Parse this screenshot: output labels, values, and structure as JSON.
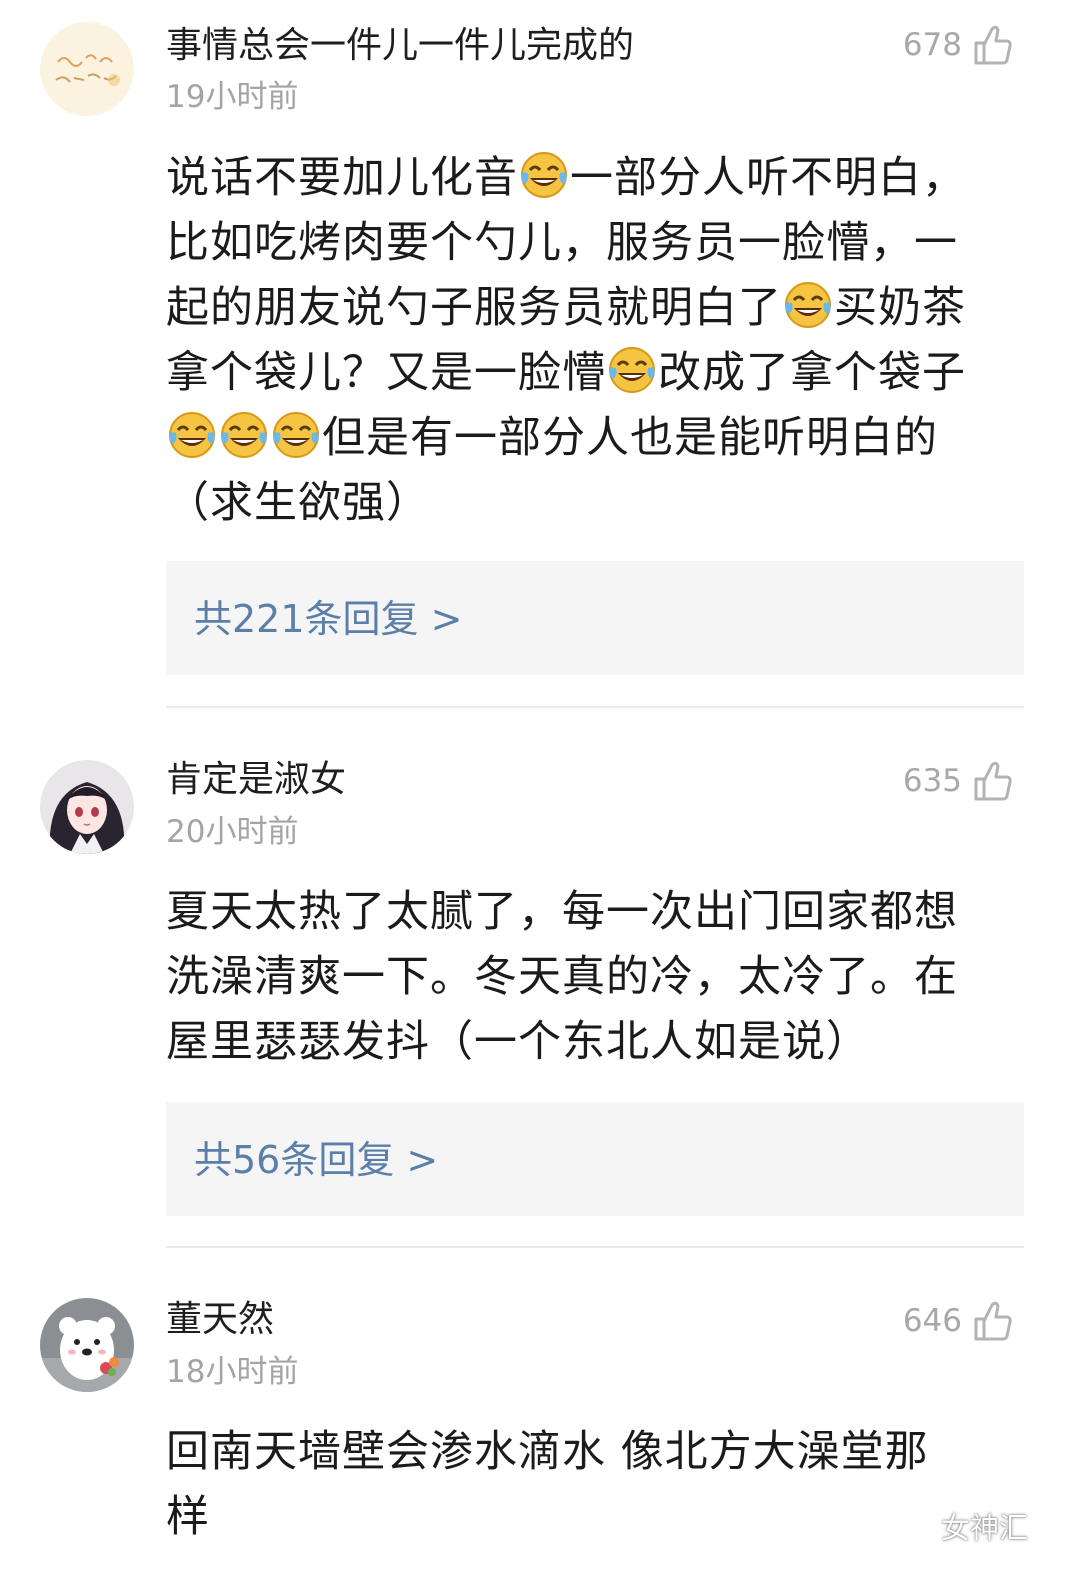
{
  "colors": {
    "reply_link": "#5b7fa8",
    "muted": "#a4a4a4",
    "reply_bg": "#f5f5f5"
  },
  "comments": [
    {
      "username": "事情总会一件儿一件儿完成的",
      "time": "19小时前",
      "likes": "678",
      "avatar_icon": "calligraphy-avatar-icon",
      "lines": [
        [
          "说话不要加儿化音",
          "😂",
          "一部分人听不明白，"
        ],
        [
          "比如吃烤肉要个勺儿，服务员一脸懵，一"
        ],
        [
          "起的朋友说勺子服务员就明白了",
          "😂",
          "买奶茶"
        ],
        [
          "拿个袋儿？又是一脸懵",
          "😂",
          "改成了拿个袋子"
        ],
        [
          "😂",
          "😂",
          "😂",
          "但是有一部分人也是能听明白的"
        ],
        [
          "（求生欲强）"
        ]
      ],
      "replies": "共221条回复 >"
    },
    {
      "username": "肯定是淑女",
      "time": "20小时前",
      "likes": "635",
      "avatar_icon": "anime-girl-avatar-icon",
      "lines": [
        [
          "夏天太热了太腻了，每一次出门回家都想"
        ],
        [
          "洗澡清爽一下。冬天真的冷，太冷了。在"
        ],
        [
          "屋里瑟瑟发抖（一个东北人如是说）"
        ]
      ],
      "replies": "共56条回复 >"
    },
    {
      "username": "董天然",
      "time": "18小时前",
      "likes": "646",
      "avatar_icon": "polar-bear-avatar-icon",
      "lines": [
        [
          "回南天墙壁会渗水滴水   像北方大澡堂那"
        ],
        [
          "样"
        ]
      ]
    }
  ],
  "watermark": {
    "icon": "wechat-icon",
    "text": "女神汇"
  }
}
